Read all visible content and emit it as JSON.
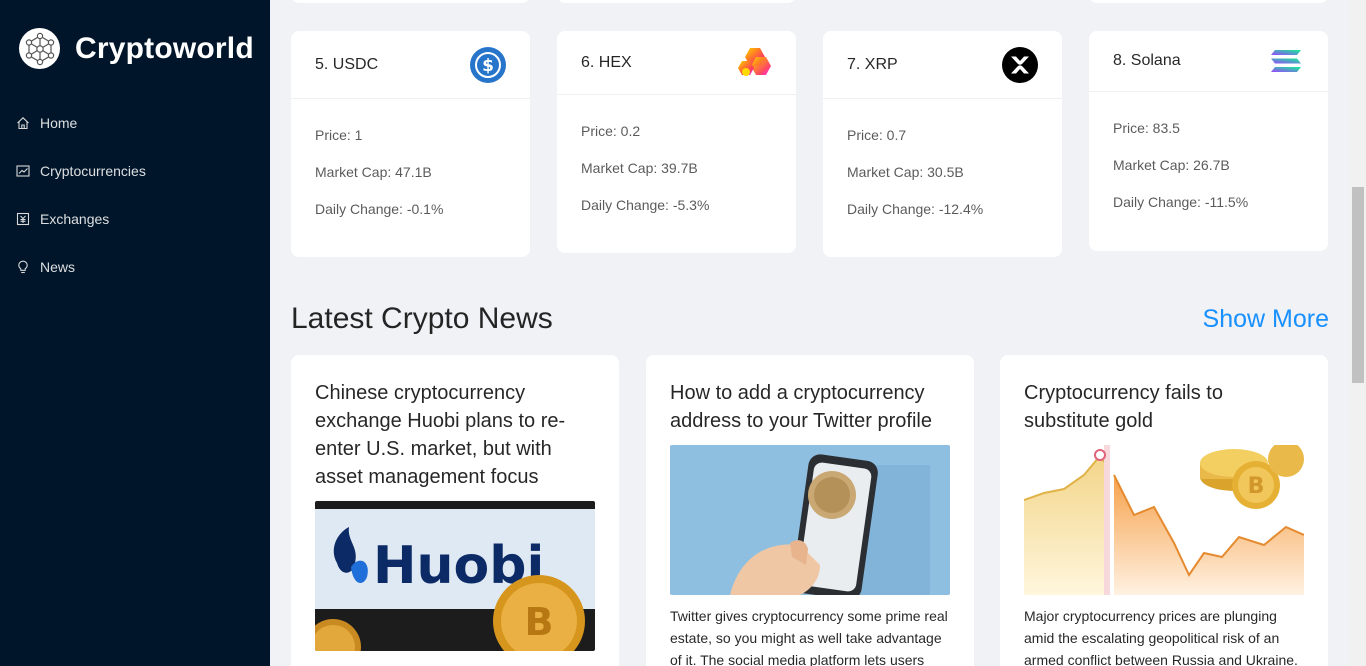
{
  "brand": {
    "title": "Cryptoworld"
  },
  "menu": [
    {
      "label": "Home",
      "icon": "home-icon"
    },
    {
      "label": "Cryptocurrencies",
      "icon": "chart-icon"
    },
    {
      "label": "Exchanges",
      "icon": "exchange-icon"
    },
    {
      "label": "News",
      "icon": "bulb-icon"
    }
  ],
  "coins": [
    {
      "name": "5. USDC",
      "price": "Price: 1",
      "market_cap": "Market Cap: 47.1B",
      "daily_change": "Daily Change: -0.1%",
      "icon": "usdc-icon"
    },
    {
      "name": "6. HEX",
      "price": "Price: 0.2",
      "market_cap": "Market Cap: 39.7B",
      "daily_change": "Daily Change: -5.3%",
      "icon": "hex-icon"
    },
    {
      "name": "7. XRP",
      "price": "Price: 0.7",
      "market_cap": "Market Cap: 30.5B",
      "daily_change": "Daily Change: -12.4%",
      "icon": "xrp-icon"
    },
    {
      "name": "8. Solana",
      "price": "Price: 83.5",
      "market_cap": "Market Cap: 26.7B",
      "daily_change": "Daily Change: -11.5%",
      "icon": "solana-icon"
    }
  ],
  "news_section": {
    "heading": "Latest Crypto News",
    "show_more": "Show More"
  },
  "news": [
    {
      "title": "Chinese cryptocurrency exchange Huobi plans to re-enter U.S. market, but with asset management focus",
      "image": "huobi-logo-image",
      "image_text": "Huobi",
      "description": ""
    },
    {
      "title": "How to add a cryptocurrency address to your Twitter profile",
      "image": "phone-with-coin-image",
      "description": "Twitter gives cryptocurrency some prime real estate, so you might as well take advantage of it. The social media platform lets users add"
    },
    {
      "title": "Cryptocurrency fails to substitute gold",
      "image": "gold-vs-bitcoin-chart-image",
      "description": "Major cryptocurrency prices are plunging amid the escalating geopolitical risk of an armed conflict between Russia and Ukraine."
    }
  ],
  "colors": {
    "sidebar": "#001529",
    "accent": "#1890ff",
    "background": "#f0f2f5"
  }
}
